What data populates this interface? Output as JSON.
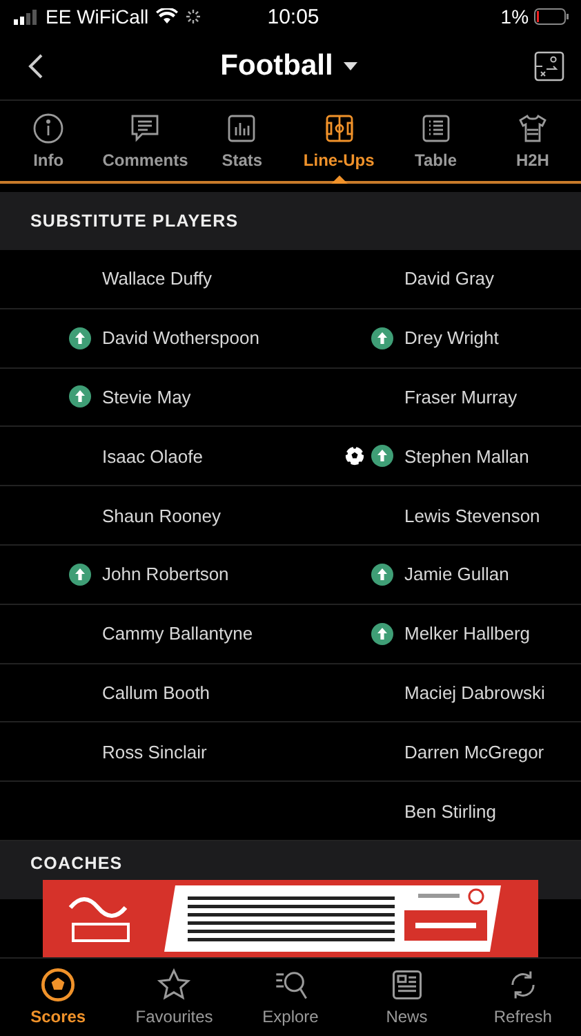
{
  "status_bar": {
    "carrier": "EE WiFiCall",
    "time": "10:05",
    "battery": "1%"
  },
  "header": {
    "title": "Football"
  },
  "tabs": [
    {
      "label": "Info",
      "kind": "info",
      "selected": false
    },
    {
      "label": "Comments",
      "kind": "comments",
      "selected": false
    },
    {
      "label": "Stats",
      "kind": "stats",
      "selected": false
    },
    {
      "label": "Line-Ups",
      "kind": "lineups",
      "selected": true
    },
    {
      "label": "Table",
      "kind": "table",
      "selected": false
    },
    {
      "label": "H2H",
      "kind": "shirt",
      "selected": false
    }
  ],
  "substitutes": {
    "title": "SUBSTITUTE PLAYERS",
    "rows": [
      {
        "left": {
          "name": "Wallace Duffy",
          "subbed_on": false,
          "goal": false
        },
        "right": {
          "name": "David Gray",
          "subbed_on": false,
          "goal": false
        }
      },
      {
        "left": {
          "name": "David Wotherspoon",
          "subbed_on": true,
          "goal": false
        },
        "right": {
          "name": "Drey Wright",
          "subbed_on": true,
          "goal": false
        }
      },
      {
        "left": {
          "name": "Stevie May",
          "subbed_on": true,
          "goal": false
        },
        "right": {
          "name": "Fraser Murray",
          "subbed_on": false,
          "goal": false
        }
      },
      {
        "left": {
          "name": "Isaac Olaofe",
          "subbed_on": false,
          "goal": false
        },
        "right": {
          "name": "Stephen Mallan",
          "subbed_on": true,
          "goal": true
        }
      },
      {
        "left": {
          "name": "Shaun Rooney",
          "subbed_on": false,
          "goal": false
        },
        "right": {
          "name": "Lewis Stevenson",
          "subbed_on": false,
          "goal": false
        }
      },
      {
        "left": {
          "name": "John Robertson",
          "subbed_on": true,
          "goal": false
        },
        "right": {
          "name": "Jamie Gullan",
          "subbed_on": true,
          "goal": false
        }
      },
      {
        "left": {
          "name": "Cammy Ballantyne",
          "subbed_on": false,
          "goal": false
        },
        "right": {
          "name": "Melker Hallberg",
          "subbed_on": true,
          "goal": false
        }
      },
      {
        "left": {
          "name": "Callum Booth",
          "subbed_on": false,
          "goal": false
        },
        "right": {
          "name": "Maciej Dabrowski",
          "subbed_on": false,
          "goal": false
        }
      },
      {
        "left": {
          "name": "Ross Sinclair",
          "subbed_on": false,
          "goal": false
        },
        "right": {
          "name": "Darren McGregor",
          "subbed_on": false,
          "goal": false
        }
      },
      {
        "right": {
          "name": "Ben Stirling",
          "subbed_on": false,
          "goal": false
        }
      }
    ]
  },
  "coaches": {
    "title": "COACHES"
  },
  "nav": [
    {
      "label": "Scores",
      "kind": "ball",
      "selected": true
    },
    {
      "label": "Favourites",
      "kind": "star",
      "selected": false
    },
    {
      "label": "Explore",
      "kind": "explore",
      "selected": false
    },
    {
      "label": "News",
      "kind": "news",
      "selected": false
    },
    {
      "label": "Refresh",
      "kind": "refresh",
      "selected": false
    }
  ]
}
